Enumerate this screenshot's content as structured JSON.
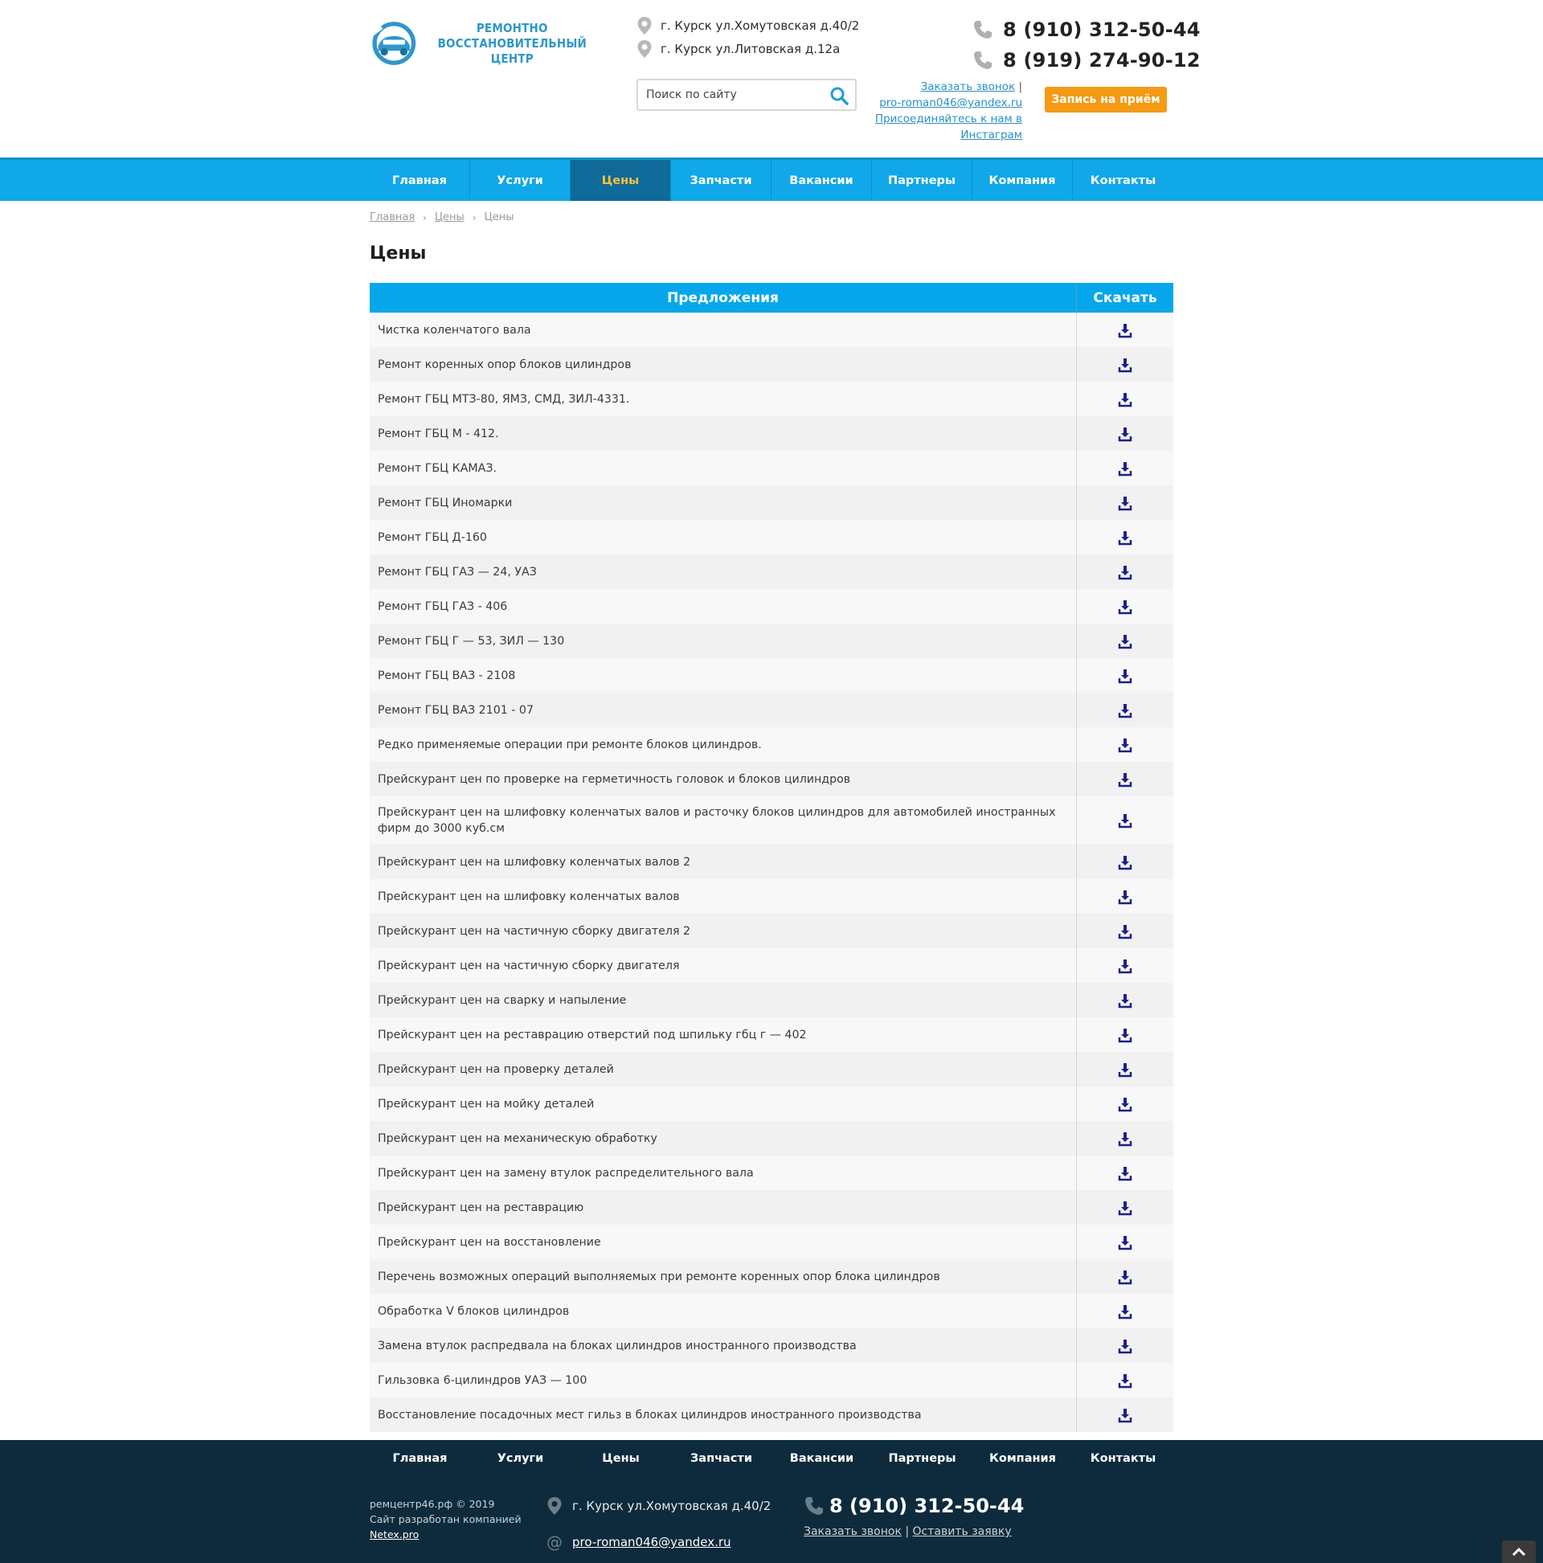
{
  "header": {
    "logo_lines": [
      "РЕМОНТНО",
      "ВОССТАНОВИТЕЛЬНЫЙ",
      "ЦЕНТР"
    ],
    "addresses": [
      "г. Курск ул.Хомутовская д.40/2",
      "г. Курск ул.Литовская д.12а"
    ],
    "search_placeholder": "Поиск по сайту",
    "phones": [
      "8 (910) 312-50-44",
      "8 (919) 274-90-12"
    ],
    "callback_label": "Заказать звонок",
    "email": "pro-roman046@yandex.ru",
    "instagram_label_1": "Присоединяйтесь к нам в",
    "instagram_label_2": "Инстаграм",
    "appointment_button": "Запись на приём",
    "brand_color": "#10a8e8",
    "accent_color": "#f59a14"
  },
  "nav": {
    "items": [
      "Главная",
      "Услуги",
      "Цены",
      "Запчасти",
      "Вакансии",
      "Партнеры",
      "Компания",
      "Контакты"
    ],
    "active": "Цены"
  },
  "breadcrumb": [
    "Главная",
    "Цены",
    "Цены"
  ],
  "page_title": "Цены",
  "table": {
    "col_offers": "Предложения",
    "col_download": "Скачать",
    "download_icon": "download-icon",
    "rows": [
      "Чистка коленчатого вала",
      "Ремонт коренных опор блоков цилиндров",
      "Ремонт ГБЦ МТЗ-80, ЯМЗ, СМД, ЗИЛ-4331.",
      "Ремонт ГБЦ М - 412.",
      "Ремонт ГБЦ КАМАЗ.",
      "Ремонт ГБЦ Иномарки",
      "Ремонт ГБЦ Д-160",
      "Ремонт ГБЦ ГАЗ — 24, УАЗ",
      "Ремонт ГБЦ ГАЗ - 406",
      "Ремонт ГБЦ Г — 53, ЗИЛ — 130",
      "Ремонт ГБЦ ВАЗ - 2108",
      "Ремонт ГБЦ ВАЗ 2101 - 07",
      "Редко применяемые операции при ремонте блоков цилиндров.",
      "Прейскурант цен по проверке на герметичность головок и блоков цилиндров",
      "Прейскурант цен на шлифовку коленчатых валов и расточку блоков цилиндров для автомобилей иностранных фирм до 3000 куб.см",
      "Прейскурант цен на шлифовку коленчатых валов 2",
      "Прейскурант цен на шлифовку коленчатых валов",
      "Прейскурант цен на частичную сборку двигателя 2",
      "Прейскурант цен на частичную сборку двигателя",
      "Прейскурант цен на сварку и напыление",
      "Прейскурант цен на реставрацию отверстий под шпильку гбц г — 402",
      "Прейскурант цен на проверку деталей",
      "Прейскурант цен на мойку деталей",
      "Прейскурант цен на механическую обработку",
      "Прейскурант цен на замену втулок распределительного вала",
      "Прейскурант цен на реставрацию",
      "Прейскурант цен на восстановление",
      "Перечень возможных операций выполняемых при ремонте коренных опор блока цилиндров",
      "Обработка V блоков цилиндров",
      "Замена втулок распредвала на блоках цилиндров иностранного производства",
      "Гильзовка 6-цилиндров УАЗ — 100",
      "Восстановление посадочных мест гильз в блоках цилиндров иностранного производства"
    ]
  },
  "footer": {
    "nav": [
      "Главная",
      "Услуги",
      "Цены",
      "Запчасти",
      "Вакансии",
      "Партнеры",
      "Компания",
      "Контакты"
    ],
    "copyright": "ремцентр46.рф © 2019",
    "developer_text": "Сайт разработан компанией",
    "developer_link": "Netex.pro",
    "address": "г. Курск ул.Хомутовская д.40/2",
    "email": "pro-roman046@yandex.ru",
    "phone": "8 (910) 312-50-44",
    "callback_label": "Заказать звонок",
    "request_label": "Оставить заявку",
    "background_color": "#0d2b3c"
  }
}
